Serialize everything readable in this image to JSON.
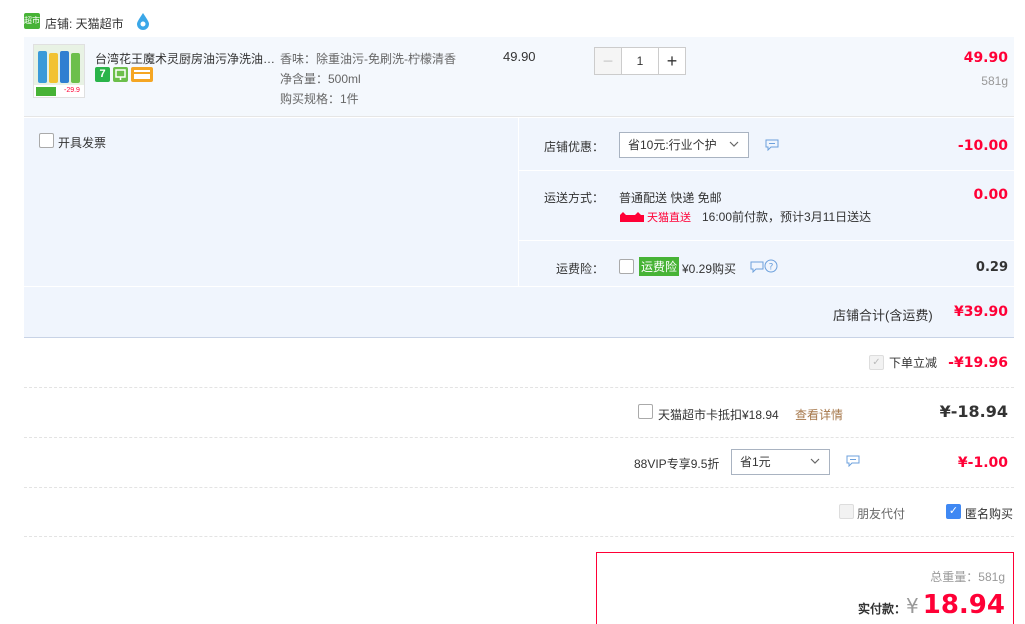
{
  "shop": {
    "icon_text": "超市",
    "label": "店铺: 天猫超市",
    "drop_icon": "water-drop-icon"
  },
  "item": {
    "name": "台湾花王魔术灵厨房油污净洗油…",
    "img_price": "-29.9",
    "badges": [
      "7",
      "",
      ""
    ],
    "sku_scent": "香味：除重油污-免刷洗-柠檬清香",
    "sku_volume": "净含量：500ml",
    "sku_spec": "购买规格：1件",
    "unit_price": "49.90",
    "quantity": "1",
    "total": "49.90",
    "weight": "581g"
  },
  "invoice": {
    "label": "开具发票"
  },
  "discount": {
    "label": "店铺优惠：",
    "selected": "省10元:行业个护",
    "amount": "-10.00"
  },
  "shipping": {
    "label": "运送方式：",
    "method": "普通配送 快递 免邮",
    "tag": "天猫直送",
    "eta": "16:00前付款，预计3月11日送达",
    "amount": "0.00"
  },
  "insurance": {
    "label": "运费险：",
    "tag": "运费险",
    "price_text": "¥0.29购买",
    "amount": "0.29"
  },
  "shop_total": {
    "label": "店铺合计(含运费)",
    "amount": "¥39.90"
  },
  "instant_discount": {
    "label": "下单立减",
    "amount": "-¥19.96"
  },
  "card_deduct": {
    "label": "天猫超市卡抵扣¥18.94",
    "link": "查看详情",
    "amount": "¥-18.94"
  },
  "vip": {
    "label": "88VIP专享9.5折",
    "selected": "省1元",
    "amount": "¥-1.00"
  },
  "friend_pay": {
    "label": "朋友代付"
  },
  "anonymous": {
    "label": "匿名购买"
  },
  "summary": {
    "weight_label": "总重量：581g",
    "pay_label": "实付款：",
    "currency": "¥",
    "pay_amount": "18.94"
  },
  "colors": {
    "accent_red": "#ff0036",
    "option_bg": "#f0f5fd",
    "checkbox_blue": "#3f88f3",
    "tmall_green": "#47b336"
  }
}
